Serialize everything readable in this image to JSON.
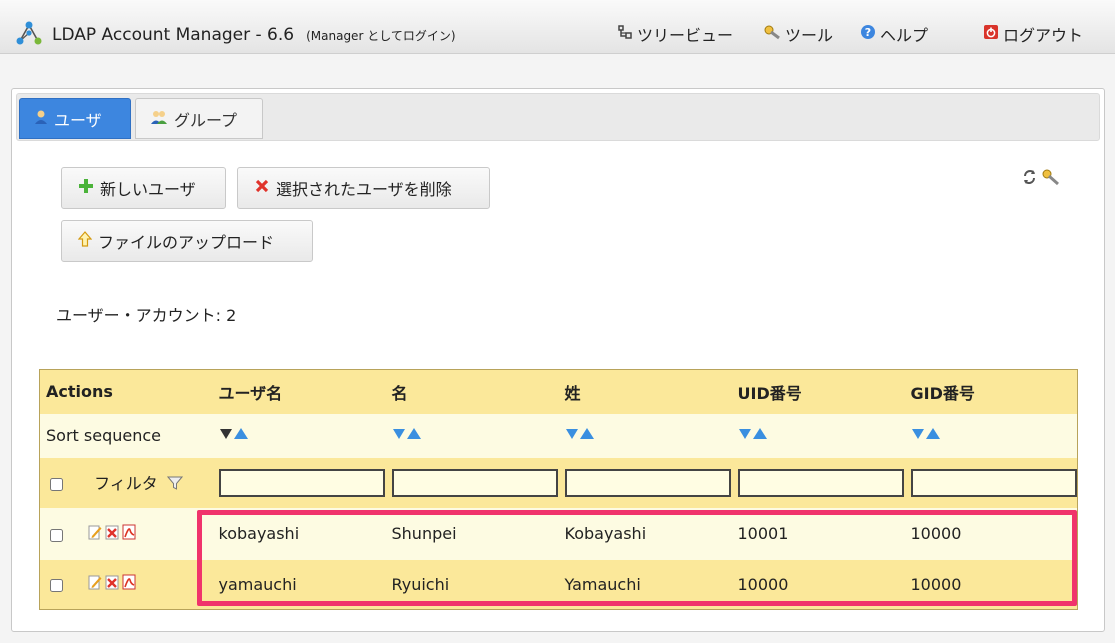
{
  "header": {
    "app_title": "LDAP Account Manager - 6.6",
    "login_note": "(Manager としてログイン)",
    "nav": {
      "tree_view": "ツリービュー",
      "tools": "ツール",
      "help": "ヘルプ",
      "logout": "ログアウト"
    }
  },
  "tabs": [
    {
      "label": "ユーザ",
      "active": true
    },
    {
      "label": "グループ",
      "active": false
    }
  ],
  "buttons": {
    "new_user": "新しいユーザ",
    "delete_selected": "選択されたユーザを削除",
    "file_upload": "ファイルのアップロード"
  },
  "account_count": "ユーザー・アカウント: 2",
  "table": {
    "columns": [
      "Actions",
      "ユーザ名",
      "名",
      "姓",
      "UID番号",
      "GID番号"
    ],
    "sort_label": "Sort sequence",
    "filter_label": "フィルタ",
    "rows": [
      {
        "uid": "kobayashi",
        "first_name": "Shunpei",
        "last_name": "Kobayashi",
        "uid_number": "10001",
        "gid_number": "10000"
      },
      {
        "uid": "yamauchi",
        "first_name": "Ryuichi",
        "last_name": "Yamauchi",
        "uid_number": "10000",
        "gid_number": "10000"
      }
    ]
  },
  "colors": {
    "tab_active": "#3d86df",
    "table_header": "#fbe89a",
    "table_row_light": "#fdfbe2",
    "highlight_border": "#f0336b"
  }
}
